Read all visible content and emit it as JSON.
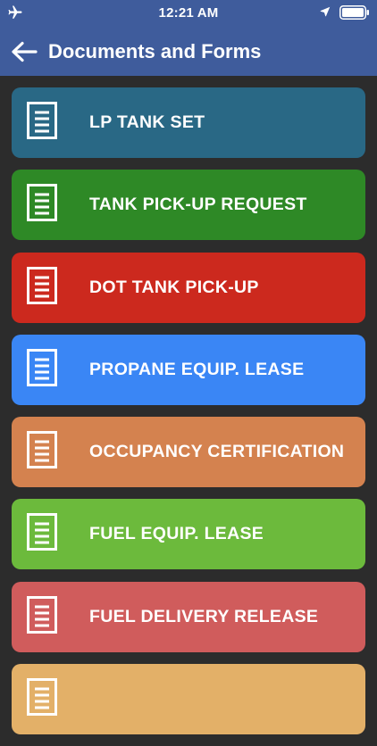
{
  "status_bar": {
    "time": "12:21 AM",
    "icons": [
      "airplane-icon",
      "location-icon",
      "battery-icon"
    ]
  },
  "nav": {
    "title": "Documents and Forms",
    "back_icon": "arrow-left-icon"
  },
  "colors": {
    "header": "#3f5c9c",
    "background": "#2c2c2c"
  },
  "forms": [
    {
      "label": "LP TANK SET",
      "color": "#296885",
      "icon": "document-icon"
    },
    {
      "label": "TANK PICK-UP REQUEST",
      "color": "#2e8926",
      "icon": "document-icon"
    },
    {
      "label": "DOT TANK PICK-UP",
      "color": "#cc291e",
      "icon": "document-icon"
    },
    {
      "label": "PROPANE EQUIP. LEASE",
      "color": "#3a86f5",
      "icon": "document-icon"
    },
    {
      "label": "OCCUPANCY CERTIFICATION",
      "color": "#d4824f",
      "icon": "document-icon"
    },
    {
      "label": "FUEL EQUIP. LEASE",
      "color": "#6cba3c",
      "icon": "document-icon"
    },
    {
      "label": "FUEL DELIVERY RELEASE",
      "color": "#d05c5c",
      "icon": "document-icon"
    },
    {
      "label": "",
      "color": "#e3b068",
      "icon": "document-icon"
    }
  ]
}
